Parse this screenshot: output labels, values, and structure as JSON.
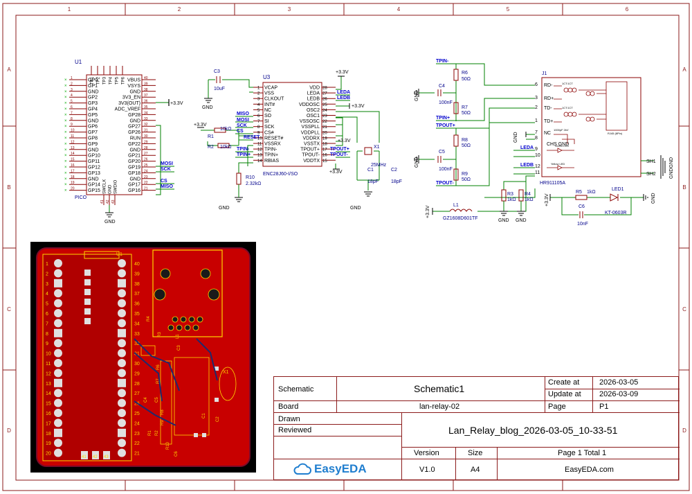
{
  "colors": {
    "frame": "#8b1a1a",
    "wire": "#008000",
    "pin": "#880000",
    "label": "#00008b",
    "component": "#8b0000",
    "net_label": "#0000cc",
    "pcb_copper": "#c80000",
    "pcb_silk": "#ffd700",
    "pcb_board": "#000000"
  },
  "frame": {
    "columns": [
      "1",
      "2",
      "3",
      "4",
      "5",
      "6"
    ],
    "rows": [
      "A",
      "B",
      "C",
      "D"
    ]
  },
  "u1": {
    "ref": "U1",
    "part": "PICO",
    "top_pins": [
      "TP1",
      "TP2",
      "TP3",
      "TP4",
      "TP5",
      "TP6"
    ],
    "left_pins": [
      "GP0",
      "GP1",
      "GND",
      "GP2",
      "GP3",
      "GP4",
      "GP5",
      "GND",
      "GP6",
      "GP7",
      "GP8",
      "GP9",
      "GND",
      "GP10",
      "GP11",
      "GP12",
      "GP13",
      "GND",
      "GP14",
      "GP15"
    ],
    "left_nums": [
      "1",
      "2",
      "3",
      "4",
      "5",
      "6",
      "7",
      "8",
      "9",
      "10",
      "11",
      "12",
      "13",
      "14",
      "15",
      "16",
      "17",
      "18",
      "19",
      "20"
    ],
    "right_pins": [
      "VBUS",
      "VSYS",
      "GND",
      "3V3_EN",
      "3V3(OUT)",
      "ADC_VREF",
      "GP28",
      "GND",
      "GP27",
      "GP26",
      "RUN",
      "GP22",
      "GND",
      "GP21",
      "GP20",
      "GP19",
      "GP18",
      "GND",
      "GP17",
      "GP16"
    ],
    "right_nums": [
      "40",
      "39",
      "38",
      "37",
      "36",
      "35",
      "34",
      "33",
      "32",
      "31",
      "30",
      "29",
      "28",
      "27",
      "26",
      "25",
      "24",
      "23",
      "22",
      "21"
    ],
    "bottom_pins": [
      "SWCLK",
      "GND",
      "SWDIO"
    ],
    "bottom_nums": [
      "41",
      "42",
      "43"
    ],
    "nets": {
      "mosi": "MOSI",
      "sck": "SCK",
      "cs": "CS",
      "miso": "MISO",
      "v33": "+3.3V",
      "gnd": "GND"
    }
  },
  "u3": {
    "ref": "U3",
    "part": "ENC28J60-I/SO",
    "left_pins": [
      "VCAP",
      "VSS",
      "CLKOUT",
      "INT#",
      "NC",
      "SO",
      "SI",
      "SCK",
      "CS#",
      "RESET#",
      "VSSRX",
      "TPIN-",
      "TPIN+",
      "RBIAS"
    ],
    "left_nums": [
      "1",
      "2",
      "3",
      "4",
      "5",
      "6",
      "7",
      "8",
      "9",
      "10",
      "11",
      "12",
      "13",
      "14"
    ],
    "right_pins": [
      "VDD",
      "LEDA",
      "LEDB",
      "VDDOSC",
      "OSC2",
      "OSC1",
      "VSSOSC",
      "VSSPLL",
      "VDDPLL",
      "VDDRX",
      "VSSTX",
      "TPOUT+",
      "TPOUT-",
      "VDDTX"
    ],
    "right_nums": [
      "28",
      "27",
      "26",
      "25",
      "24",
      "23",
      "22",
      "21",
      "20",
      "19",
      "18",
      "17",
      "16",
      "15"
    ],
    "c3_ref": "C3",
    "c3_val": "10uF",
    "r1_ref": "R1",
    "r1_val": "10kΩ",
    "r2_ref": "R2",
    "r2_val": "10kΩ",
    "r10_ref": "R10",
    "r10_val": "2.32kΩ",
    "x1_ref": "X1",
    "x1_val": "25MHz",
    "c1_ref": "C1",
    "c1_val": "18pF",
    "c2_ref": "C2",
    "c2_val": "18pF",
    "nets": {
      "miso": "MISO",
      "mosi": "MOSI",
      "sck": "SCK",
      "cs": "CS",
      "reset": "RESET",
      "tpin_m": "TPIN-",
      "tpin_p": "TPIN+",
      "leda": "LEDA",
      "ledb": "LEDB",
      "tpout_p": "TPOUT+",
      "tpout_m": "TPOUT-",
      "v33": "+3.3V",
      "gnd": "GND"
    }
  },
  "magjack": {
    "nets": {
      "tpin_m": "TPIN-",
      "tpin_p": "TPIN+",
      "tpout_p": "TPOUT+",
      "tpout_m": "TPOUT-",
      "leda": "LEDA",
      "ledb": "LEDB",
      "v33": "+3.3V",
      "gnd": "GND",
      "chs_gnd": "CHS GND",
      "gndgnd": "GNDGND"
    },
    "r6_ref": "R6",
    "r6_val": "50Ω",
    "r7_ref": "R7",
    "r7_val": "50Ω",
    "r8_ref": "R8",
    "r8_val": "50Ω",
    "r9_ref": "R9",
    "r9_val": "50Ω",
    "c4_ref": "C4",
    "c4_val": "100nF",
    "c5_ref": "C5",
    "c5_val": "100nF",
    "r3_ref": "R3",
    "r3_val": "1kΩ",
    "r4_ref": "R4",
    "r4_val": "1kΩ",
    "l1_ref": "L1",
    "l1_val": "GZ1608D601TF",
    "r5_ref": "R5",
    "r5_val": "1kΩ",
    "c6_ref": "C6",
    "c6_val": "10nF",
    "led1_ref": "LED1",
    "led1_val": "KT-0603R",
    "j1_ref": "J1",
    "j1_part": "HR911105A",
    "j1_pins": [
      "RD-",
      "RD+",
      "TD-",
      "TD+",
      "NC"
    ],
    "j1_nums": [
      "6",
      "3",
      "2",
      "1",
      "7",
      "8"
    ],
    "j1_led_nums": [
      "9",
      "10",
      "12",
      "11"
    ],
    "sh1": "SH1",
    "sh2": "SH2",
    "tiny": {
      "green_led": "Green LED",
      "yellow_led": "Yellow LED",
      "cap_1000": "1000pF 2kV",
      "ratio": "1CT:1CT",
      "ratio2": "1CT:1CT",
      "rj45": "RJ45 (8Pin)"
    }
  },
  "pcb": {
    "u1_label": "U1",
    "x1_label": "X1",
    "left_nums": [
      "1",
      "2",
      "3",
      "4",
      "5",
      "6",
      "7",
      "8",
      "9",
      "10",
      "11",
      "12",
      "13",
      "14",
      "15",
      "16",
      "17",
      "18",
      "19",
      "20"
    ],
    "right_nums": [
      "40",
      "39",
      "38",
      "37",
      "36",
      "35",
      "34",
      "33",
      "32",
      "31",
      "30",
      "29",
      "28",
      "27",
      "26",
      "25",
      "24",
      "23",
      "22",
      "21"
    ],
    "bottom_nums": [
      "41",
      "42",
      "43"
    ],
    "silk_labels": [
      "R4",
      "R3",
      "C4",
      "C5",
      "R6",
      "R7",
      "R8",
      "R9",
      "L1",
      "C3",
      "R1",
      "R2",
      "R10",
      "C6",
      "C1",
      "C2"
    ]
  },
  "title_block": {
    "schematic_label": "Schematic",
    "schematic_value": "Schematic1",
    "create_label": "Create at",
    "create_value": "2026-03-05",
    "update_label": "Update at",
    "update_value": "2026-03-09",
    "board_label": "Board",
    "board_value": "lan-relay-02",
    "page_label": "Page",
    "page_value": "P1",
    "drawn_label": "Drawn",
    "reviewed_label": "Reviewed",
    "project_name": "Lan_Relay_blog_2026-03-05_10-33-51",
    "version_label": "Version",
    "size_label": "Size",
    "page_total": "Page  1  Total  1",
    "version_value": "V1.0",
    "size_value": "A4",
    "footer_site": "EasyEDA.com",
    "logo_text": "EasyEDA"
  }
}
